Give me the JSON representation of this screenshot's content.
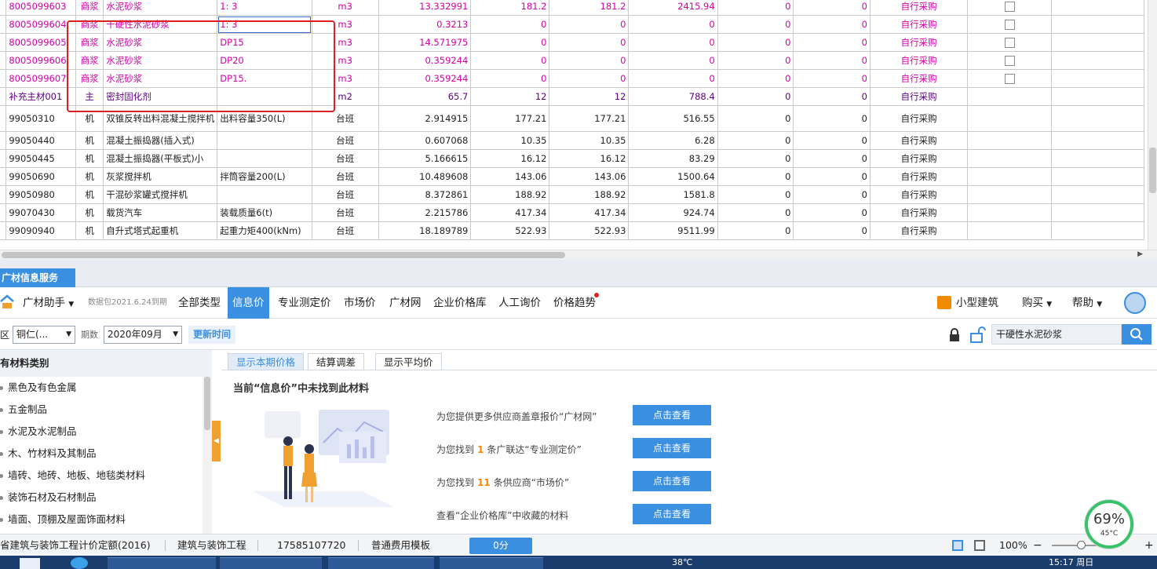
{
  "grid": {
    "rows": [
      {
        "code": "8005099603",
        "type": "商浆",
        "name": "水泥砂浆",
        "spec": "1: 3",
        "unit": "m3",
        "qty": "13.332991",
        "p1": "181.2",
        "p2": "181.2",
        "amount": "2415.94",
        "z1": "0",
        "z2": "0",
        "source": "自行采购",
        "check": true,
        "style": "pink"
      },
      {
        "code": "8005099604",
        "type": "商浆",
        "name": "干硬性水泥砂浆",
        "spec": "1: 3",
        "unit": "m3",
        "qty": "0.3213",
        "p1": "0",
        "p2": "0",
        "amount": "0",
        "z1": "0",
        "z2": "0",
        "source": "自行采购",
        "check": true,
        "style": "pink",
        "edit": true
      },
      {
        "code": "8005099605",
        "type": "商浆",
        "name": "水泥砂浆",
        "spec": "DP15",
        "unit": "m3",
        "qty": "14.571975",
        "p1": "0",
        "p2": "0",
        "amount": "0",
        "z1": "0",
        "z2": "0",
        "source": "自行采购",
        "check": true,
        "style": "pink"
      },
      {
        "code": "8005099606",
        "type": "商浆",
        "name": "水泥砂浆",
        "spec": "DP20",
        "unit": "m3",
        "qty": "0.359244",
        "p1": "0",
        "p2": "0",
        "amount": "0",
        "z1": "0",
        "z2": "0",
        "source": "自行采购",
        "check": true,
        "style": "pink"
      },
      {
        "code": "8005099607",
        "type": "商浆",
        "name": "水泥砂浆",
        "spec": "DP15.",
        "unit": "m3",
        "qty": "0.359244",
        "p1": "0",
        "p2": "0",
        "amount": "0",
        "z1": "0",
        "z2": "0",
        "source": "自行采购",
        "check": true,
        "style": "pink"
      },
      {
        "code": "补充主材001",
        "type": "主",
        "name": "密封固化剂",
        "spec": "",
        "unit": "m2",
        "qty": "65.7",
        "p1": "12",
        "p2": "12",
        "amount": "788.4",
        "z1": "0",
        "z2": "0",
        "source": "自行采购",
        "check": false,
        "style": "sup"
      },
      {
        "code": "99050310",
        "type": "机",
        "name": "双锥反转出料混凝土搅拌机",
        "spec": "出料容量350(L)",
        "unit": "台班",
        "qty": "2.914915",
        "p1": "177.21",
        "p2": "177.21",
        "amount": "516.55",
        "z1": "0",
        "z2": "0",
        "source": "自行采购",
        "check": false,
        "style": "normal",
        "tall": true
      },
      {
        "code": "99050440",
        "type": "机",
        "name": "混凝土振捣器(插入式)",
        "spec": "",
        "unit": "台班",
        "qty": "0.607068",
        "p1": "10.35",
        "p2": "10.35",
        "amount": "6.28",
        "z1": "0",
        "z2": "0",
        "source": "自行采购",
        "check": false,
        "style": "normal"
      },
      {
        "code": "99050445",
        "type": "机",
        "name": "混凝土振捣器(平板式)小",
        "spec": "",
        "unit": "台班",
        "qty": "5.166615",
        "p1": "16.12",
        "p2": "16.12",
        "amount": "83.29",
        "z1": "0",
        "z2": "0",
        "source": "自行采购",
        "check": false,
        "style": "normal"
      },
      {
        "code": "99050690",
        "type": "机",
        "name": "灰浆搅拌机",
        "spec": "拌筒容量200(L)",
        "unit": "台班",
        "qty": "10.489608",
        "p1": "143.06",
        "p2": "143.06",
        "amount": "1500.64",
        "z1": "0",
        "z2": "0",
        "source": "自行采购",
        "check": false,
        "style": "normal"
      },
      {
        "code": "99050980",
        "type": "机",
        "name": "干混砂浆罐式搅拌机",
        "spec": "",
        "unit": "台班",
        "qty": "8.372861",
        "p1": "188.92",
        "p2": "188.92",
        "amount": "1581.8",
        "z1": "0",
        "z2": "0",
        "source": "自行采购",
        "check": false,
        "style": "normal"
      },
      {
        "code": "99070430",
        "type": "机",
        "name": "载货汽车",
        "spec": "装载质量6(t)",
        "unit": "台班",
        "qty": "2.215786",
        "p1": "417.34",
        "p2": "417.34",
        "amount": "924.74",
        "z1": "0",
        "z2": "0",
        "source": "自行采购",
        "check": false,
        "style": "normal"
      },
      {
        "code": "99090940",
        "type": "机",
        "name": "自升式塔式起重机",
        "spec": "起重力矩400(kNm)",
        "unit": "台班",
        "qty": "18.189789",
        "p1": "522.93",
        "p2": "522.93",
        "amount": "9511.99",
        "z1": "0",
        "z2": "0",
        "source": "自行采购",
        "check": false,
        "style": "normal"
      }
    ]
  },
  "panel": {
    "title": "广材信息服务"
  },
  "nav": {
    "brand": "广材助手",
    "data_pkg": "数据包2021.6.24到期",
    "tabs": [
      "全部类型",
      "信息价",
      "专业测定价",
      "市场价",
      "广材网",
      "企业价格库",
      "人工询价",
      "价格趋势"
    ],
    "active_tab": "信息价",
    "right_items": [
      "小型建筑",
      "购买",
      "帮助"
    ]
  },
  "filters": {
    "region_label": "区",
    "region_value": "铜仁(...",
    "period_label": "期数",
    "period_value": "2020年09月",
    "update_link": "更新时间",
    "search_value": "干硬性水泥砂浆"
  },
  "categories": {
    "header": "有材料类别",
    "items": [
      "黑色及有色金属",
      "五金制品",
      "水泥及水泥制品",
      "木、竹材料及其制品",
      "墙砖、地砖、地板、地毯类材料",
      "装饰石材及石材制品",
      "墙面、顶棚及屋面饰面材料"
    ]
  },
  "content": {
    "tabs": [
      "显示本期价格",
      "结算调差",
      "显示平均价"
    ],
    "not_found": "当前“信息价”中未找到此材料",
    "info_lines": [
      {
        "prefix": "为您提供更多供应商盖章报价“广材网”",
        "num": "",
        "suffix": ""
      },
      {
        "prefix": "为您找到",
        "num": "1",
        "suffix": "条广联达“专业测定价”"
      },
      {
        "prefix": "为您找到",
        "num": "11",
        "suffix": "条供应商“市场价”"
      },
      {
        "prefix": "查看“企业价格库”中收藏的材料",
        "num": "",
        "suffix": ""
      }
    ],
    "view_button": "点击查看"
  },
  "status": {
    "quota": "省建筑与装饰工程计价定额(2016)",
    "specialty": "建筑与装饰工程",
    "phone": "17585107720",
    "template": "普通费用模板",
    "score": "0分",
    "zoom": "100%"
  },
  "gauge": {
    "value": "69%",
    "temp": "45°C"
  },
  "taskbar": {
    "weather": "38℃",
    "time": "15:17 周日"
  },
  "colors": {
    "accent": "#3b8fe0",
    "pink": "#d400a8",
    "red_box": "#e02020"
  }
}
